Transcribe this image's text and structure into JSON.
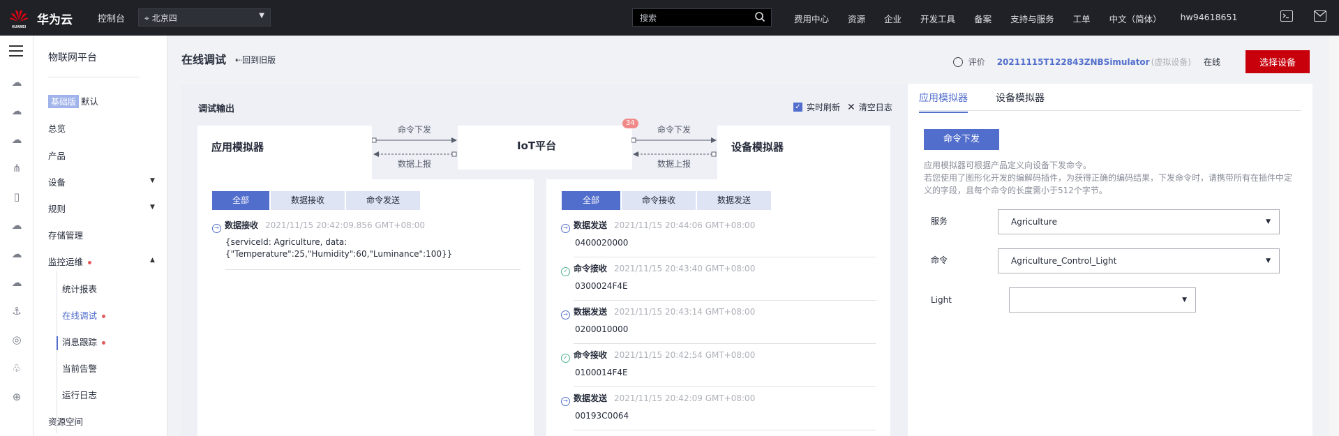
{
  "topbar": {
    "brand": "华为云",
    "logo_text": "HUAWEI",
    "console": "控制台",
    "region": "北京四",
    "search_placeholder": "搜索",
    "nav": [
      "费用中心",
      "资源",
      "企业",
      "开发工具",
      "备案",
      "支持与服务",
      "工单",
      "中文（简体）",
      "hw94618651"
    ]
  },
  "sidebar": {
    "title": "物联网平台",
    "edition_badge": "基础版",
    "edition": "默认",
    "items": [
      "总览",
      "产品",
      "设备",
      "规则",
      "存储管理",
      "监控运维"
    ],
    "sub_items": [
      "统计报表",
      "在线调试",
      "消息跟踪",
      "当前告警",
      "运行日志"
    ],
    "bottom": "资源空间"
  },
  "header": {
    "title": "在线调试",
    "back": "回到旧版",
    "evaluate": "评价",
    "device_name": "20211115T122843ZNBSimulator",
    "device_tag": "(虚拟设备)",
    "status": "在线",
    "select_device": "选择设备"
  },
  "debug": {
    "title": "调试输出",
    "realtime": "实时刷新",
    "clear": "清空日志",
    "app_sim": "应用模拟器",
    "iot": "IoT平台",
    "dev_sim": "设备模拟器",
    "cmd_down": "命令下发",
    "data_up": "数据上报",
    "badge": "34"
  },
  "left_log": {
    "tabs": [
      "全部",
      "数据接收",
      "命令发送"
    ],
    "entries": [
      {
        "kind": "数据接收",
        "time": "2021/11/15 20:42:09.856 GMT+08:00",
        "value_l1": "{serviceId: Agriculture, data:",
        "value_l2": "{\"Temperature\":25,\"Humidity\":60,\"Luminance\":100}}"
      }
    ]
  },
  "right_log": {
    "tabs": [
      "全部",
      "命令接收",
      "数据发送"
    ],
    "entries": [
      {
        "kind": "数据发送",
        "time": "2021/11/15 20:44:06 GMT+08:00",
        "value": "0400020000",
        "icon": "send"
      },
      {
        "kind": "命令接收",
        "time": "2021/11/15 20:43:40 GMT+08:00",
        "value": "0300024F4E",
        "icon": "ok"
      },
      {
        "kind": "数据发送",
        "time": "2021/11/15 20:43:14 GMT+08:00",
        "value": "0200010000",
        "icon": "send"
      },
      {
        "kind": "命令接收",
        "time": "2021/11/15 20:42:54 GMT+08:00",
        "value": "0100014F4E",
        "icon": "ok"
      },
      {
        "kind": "数据发送",
        "time": "2021/11/15 20:42:09 GMT+08:00",
        "value": "00193C0064",
        "icon": "send"
      }
    ]
  },
  "simulator": {
    "tabs": [
      "应用模拟器",
      "设备模拟器"
    ],
    "send_cmd": "命令下发",
    "desc1": "应用模拟器可根据产品定义向设备下发命令。",
    "desc2": "若您使用了图形化开发的编解码插件，为获得正确的编码结果，下发命令时，请携带所有在插件中定",
    "desc3": "义的字段，且每个命令的长度需小于512个字节。",
    "service_label": "服务",
    "service_value": "Agriculture",
    "command_label": "命令",
    "command_value": "Agriculture_Control_Light",
    "light_label": "Light",
    "light_value": ""
  }
}
